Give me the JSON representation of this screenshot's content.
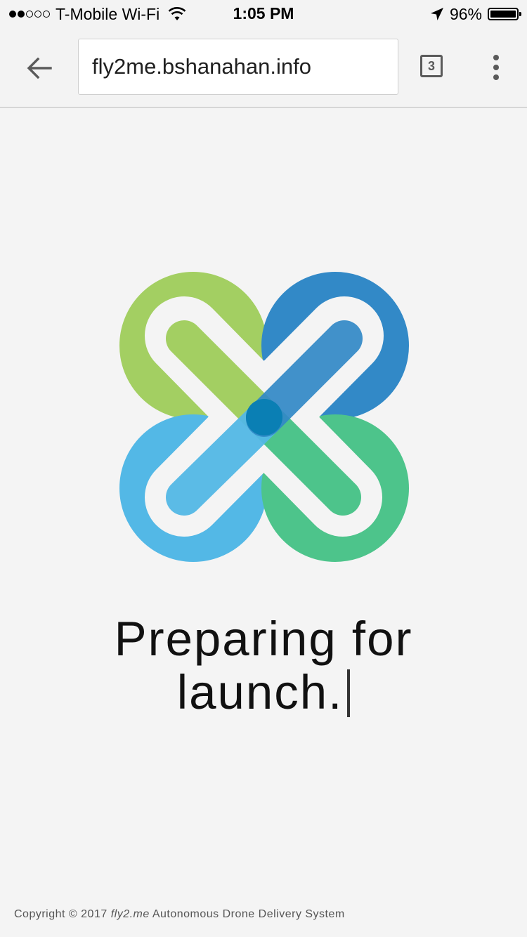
{
  "status_bar": {
    "carrier": "T-Mobile Wi-Fi",
    "time": "1:05 PM",
    "battery": "96%",
    "battery_level": 0.96,
    "signal_dots_filled": 2,
    "signal_dots_total": 5
  },
  "browser": {
    "url": "fly2me.bshanahan.info",
    "tab_count": "3"
  },
  "main": {
    "logo_colors": [
      "#a3cf62",
      "#3289c7",
      "#53b8e6",
      "#4dc48b"
    ],
    "headline_line1": "Preparing for",
    "headline_line2": "launch."
  },
  "footer": {
    "copyright": "Copyright © 2017",
    "brand": "fly2.me",
    "tagline": "Autonomous Drone Delivery System"
  }
}
